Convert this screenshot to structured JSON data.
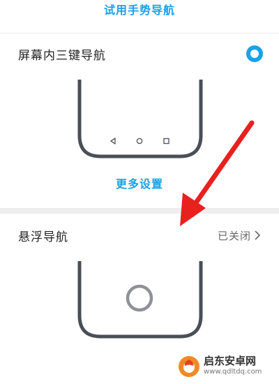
{
  "top_link": {
    "label": "试用手势导航"
  },
  "three_key_option": {
    "label": "屏幕内三键导航",
    "selected": true
  },
  "more_settings": {
    "label": "更多设置"
  },
  "floating_nav": {
    "label": "悬浮导航",
    "status": "已关闭"
  },
  "nav_icons": [
    "back-triangle-icon",
    "home-circle-icon",
    "recents-square-icon"
  ],
  "annotation": {
    "arrow": "red-arrow-icon"
  },
  "watermark": {
    "name": "启东安卓网",
    "url": "www.qdltdq.com"
  },
  "colors": {
    "accent": "#1aa1e6",
    "annotation_red": "#e8201e",
    "frame": "#4a4f57"
  }
}
